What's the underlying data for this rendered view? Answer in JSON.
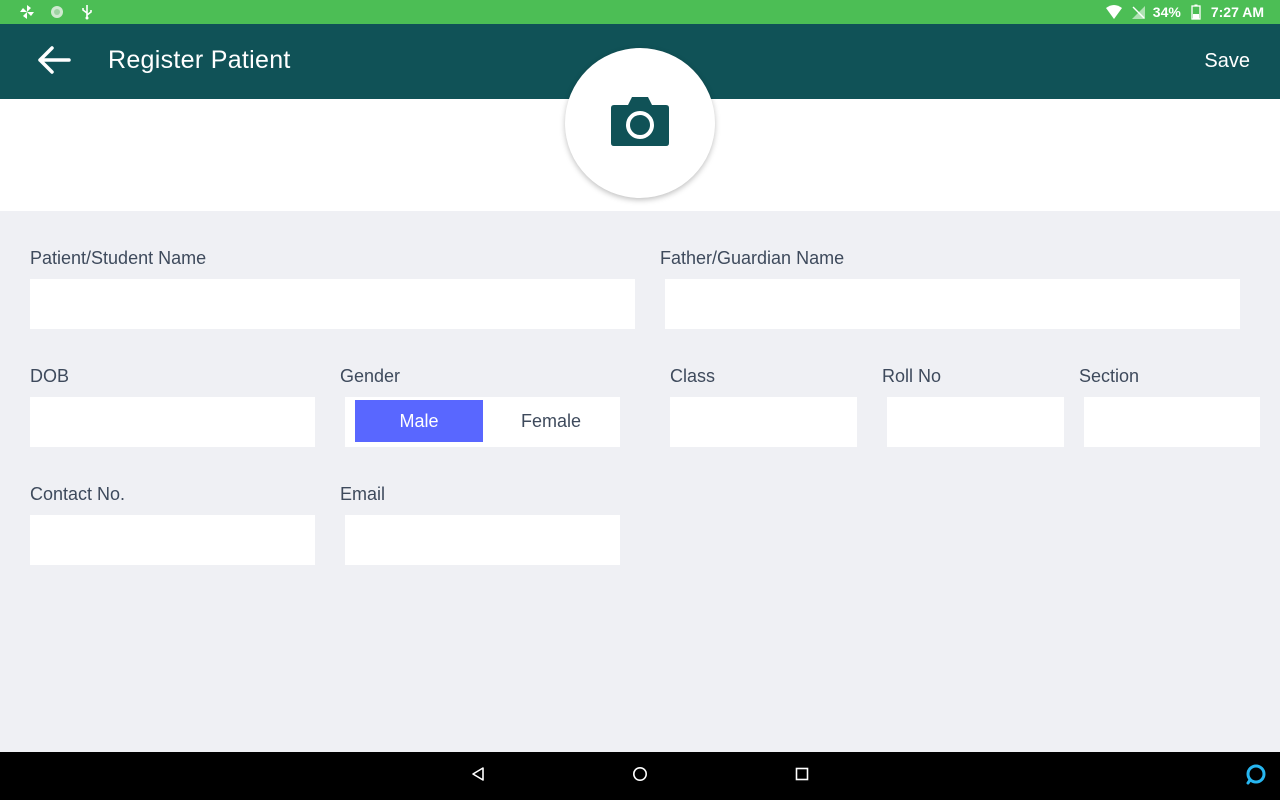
{
  "status_bar": {
    "battery": "34%",
    "time": "7:27 AM"
  },
  "app_bar": {
    "title": "Register Patient",
    "save_label": "Save"
  },
  "form": {
    "patient_name_label": "Patient/Student Name",
    "guardian_name_label": "Father/Guardian Name",
    "dob_label": "DOB",
    "gender_label": "Gender",
    "gender_options": [
      "Male",
      "Female"
    ],
    "gender_selected": "Male",
    "class_label": "Class",
    "roll_no_label": "Roll No",
    "section_label": "Section",
    "contact_label": "Contact No.",
    "email_label": "Email",
    "patient_name_value": "",
    "guardian_name_value": "",
    "dob_value": "",
    "class_value": "",
    "roll_no_value": "",
    "section_value": "",
    "contact_value": "",
    "email_value": ""
  },
  "colors": {
    "status_bar": "#4cbe55",
    "app_bar": "#105257",
    "selected_segment": "#5967ff",
    "background": "#eff0f4"
  }
}
